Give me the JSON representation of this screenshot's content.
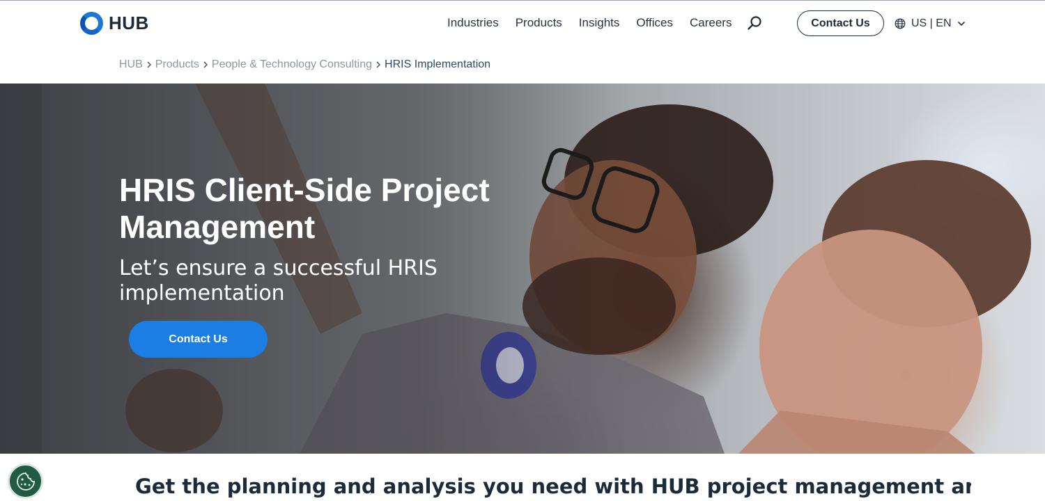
{
  "brand": {
    "name": "HUB"
  },
  "nav": {
    "items": [
      {
        "label": "Industries"
      },
      {
        "label": "Products"
      },
      {
        "label": "Insights"
      },
      {
        "label": "Offices"
      },
      {
        "label": "Careers"
      }
    ],
    "search_icon": "search-icon",
    "contact_label": "Contact Us",
    "locale_label": "US | EN",
    "locale_icon": "globe-icon"
  },
  "breadcrumb": {
    "items": [
      {
        "label": "HUB"
      },
      {
        "label": "Products"
      },
      {
        "label": "People & Technology Consulting"
      },
      {
        "label": "HRIS Implementation"
      }
    ]
  },
  "hero": {
    "title": "HRIS Client-Side Project Management",
    "subtitle": "Let’s ensure a successful HRIS implementation",
    "cta_label": "Contact Us"
  },
  "section": {
    "heading": "Get the planning and analysis you need with HUB project management and"
  },
  "cookie": {
    "icon": "cookie-icon"
  },
  "colors": {
    "accent": "#1a7ee3",
    "brand_blue": "#1a78d8",
    "text_dark": "#1c2b3a",
    "cookie_green": "#1f5b45"
  }
}
